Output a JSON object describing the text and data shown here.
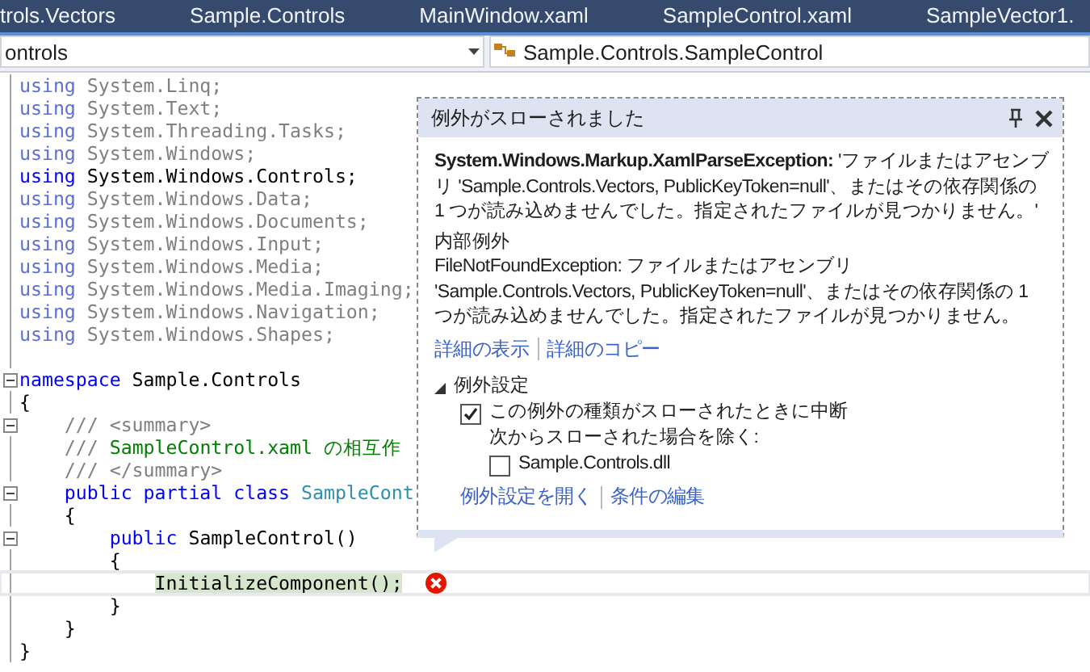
{
  "tabs": [
    {
      "label": "trols.Vectors"
    },
    {
      "label": "Sample.Controls"
    },
    {
      "label": "MainWindow.xaml"
    },
    {
      "label": "SampleControl.xaml"
    },
    {
      "label": "SampleVector1."
    }
  ],
  "navigation": {
    "left": "ontrols",
    "right": "Sample.Controls.SampleControl"
  },
  "code_lines": [
    {
      "fold": false,
      "current": false,
      "error": false,
      "segments": [
        {
          "kind": "faded_keyword",
          "text": "using"
        },
        {
          "kind": "unused",
          "text": " System.Linq;"
        }
      ]
    },
    {
      "fold": false,
      "current": false,
      "error": false,
      "segments": [
        {
          "kind": "faded_keyword",
          "text": "using"
        },
        {
          "kind": "unused",
          "text": " System.Text;"
        }
      ]
    },
    {
      "fold": false,
      "current": false,
      "error": false,
      "segments": [
        {
          "kind": "faded_keyword",
          "text": "using"
        },
        {
          "kind": "unused",
          "text": " System.Threading.Tasks;"
        }
      ]
    },
    {
      "fold": false,
      "current": false,
      "error": false,
      "segments": [
        {
          "kind": "faded_keyword",
          "text": "using"
        },
        {
          "kind": "unused",
          "text": " System.Windows;"
        }
      ]
    },
    {
      "fold": false,
      "current": false,
      "error": false,
      "segments": [
        {
          "kind": "keyword",
          "text": "using"
        },
        {
          "kind": "plain",
          "text": " System.Windows.Controls;"
        }
      ]
    },
    {
      "fold": false,
      "current": false,
      "error": false,
      "segments": [
        {
          "kind": "faded_keyword",
          "text": "using"
        },
        {
          "kind": "unused",
          "text": " System.Windows.Data;"
        }
      ]
    },
    {
      "fold": false,
      "current": false,
      "error": false,
      "segments": [
        {
          "kind": "faded_keyword",
          "text": "using"
        },
        {
          "kind": "unused",
          "text": " System.Windows.Documents;"
        }
      ]
    },
    {
      "fold": false,
      "current": false,
      "error": false,
      "segments": [
        {
          "kind": "faded_keyword",
          "text": "using"
        },
        {
          "kind": "unused",
          "text": " System.Windows.Input;"
        }
      ]
    },
    {
      "fold": false,
      "current": false,
      "error": false,
      "segments": [
        {
          "kind": "faded_keyword",
          "text": "using"
        },
        {
          "kind": "unused",
          "text": " System.Windows.Media;"
        }
      ]
    },
    {
      "fold": false,
      "current": false,
      "error": false,
      "segments": [
        {
          "kind": "faded_keyword",
          "text": "using"
        },
        {
          "kind": "unused",
          "text": " System.Windows.Media.Imaging;"
        }
      ]
    },
    {
      "fold": false,
      "current": false,
      "error": false,
      "segments": [
        {
          "kind": "faded_keyword",
          "text": "using"
        },
        {
          "kind": "unused",
          "text": " System.Windows.Navigation;"
        }
      ]
    },
    {
      "fold": false,
      "current": false,
      "error": false,
      "segments": [
        {
          "kind": "faded_keyword",
          "text": "using"
        },
        {
          "kind": "unused",
          "text": " System.Windows.Shapes;"
        }
      ]
    },
    {
      "fold": false,
      "current": false,
      "error": false
    },
    {
      "fold": true,
      "current": false,
      "error": false,
      "segments": [
        {
          "kind": "keyword",
          "text": "namespace"
        },
        {
          "kind": "plain",
          "text": " Sample.Controls"
        }
      ]
    },
    {
      "fold": false,
      "current": false,
      "error": false,
      "segments": [
        {
          "kind": "plain",
          "text": "{"
        }
      ]
    },
    {
      "fold": true,
      "current": false,
      "error": false,
      "segments": [
        {
          "kind": "doc",
          "text": "    /// <summary>"
        }
      ]
    },
    {
      "fold": false,
      "current": false,
      "error": false,
      "segments": [
        {
          "kind": "doc",
          "text": "    ///"
        },
        {
          "kind": "comment",
          "text": " SampleControl.xaml の相互作"
        }
      ]
    },
    {
      "fold": false,
      "current": false,
      "error": false,
      "segments": [
        {
          "kind": "doc",
          "text": "    /// </summary>"
        }
      ]
    },
    {
      "fold": true,
      "current": false,
      "error": false,
      "segments": [
        {
          "kind": "keyword",
          "text": "    public partial class"
        },
        {
          "kind": "type",
          "text": " SampleCont"
        }
      ]
    },
    {
      "fold": false,
      "current": false,
      "error": false,
      "segments": [
        {
          "kind": "plain",
          "text": "    {"
        }
      ]
    },
    {
      "fold": true,
      "current": false,
      "error": false,
      "segments": [
        {
          "kind": "keyword",
          "text": "        public"
        },
        {
          "kind": "plain",
          "text": " SampleControl()"
        }
      ]
    },
    {
      "fold": false,
      "current": false,
      "error": false,
      "segments": [
        {
          "kind": "plain",
          "text": "        {"
        }
      ]
    },
    {
      "fold": false,
      "current": true,
      "error": true,
      "segments": [
        {
          "kind": "highlight",
          "text": "            InitializeComponent();"
        }
      ]
    },
    {
      "fold": false,
      "current": false,
      "error": false,
      "segments": [
        {
          "kind": "plain",
          "text": "        }"
        }
      ]
    },
    {
      "fold": false,
      "current": false,
      "error": false,
      "segments": [
        {
          "kind": "plain",
          "text": "    }"
        }
      ]
    },
    {
      "fold": false,
      "current": false,
      "error": false,
      "segments": [
        {
          "kind": "plain",
          "text": "}"
        }
      ]
    }
  ],
  "exception_popup": {
    "title": "例外がスローされました",
    "message": "**System.Windows.Markup.XamlParseException:** 'ファイルまたはアセンブリ 'Sample.Controls.Vectors, PublicKeyToken=null'、またはその依存関係の 1 つが読み込めませんでした。指定されたファイルが見つかりません。'",
    "inner_heading": "内部例外",
    "inner_message": "FileNotFoundException: ファイルまたはアセンブリ 'Sample.Controls.Vectors, PublicKeyToken=null'、またはその依存関係の 1 つが読み込めませんでした。指定されたファイルが見つかりません。",
    "detail_links": [
      "詳細の表示",
      "詳細のコピー"
    ],
    "settings": {
      "title": "例外設定",
      "expanded": true,
      "break_option": {
        "label": "この例外の種類がスローされたときに中断",
        "checked": true
      },
      "except_label": "次からスローされた場合を除く:",
      "modules": [
        {
          "label": "Sample.Controls.dll",
          "checked": false
        }
      ]
    },
    "settings_links": [
      "例外設定を開く",
      "条件の編集"
    ]
  }
}
